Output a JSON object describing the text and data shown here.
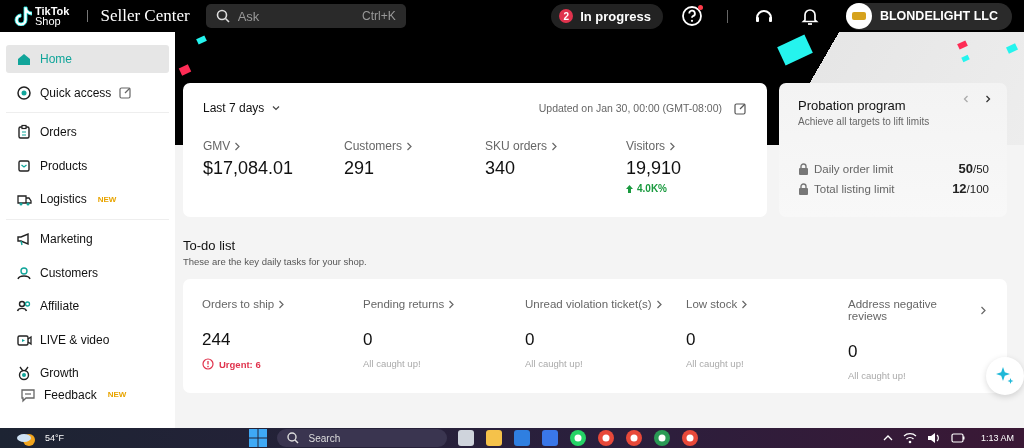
{
  "header": {
    "logo_top": "TikTok",
    "logo_bottom": "Shop",
    "brand": "Seller Center",
    "search": {
      "placeholder": "Ask",
      "shortcut": "Ctrl+K"
    },
    "status": {
      "count": "2",
      "label": "In progress"
    },
    "help_dot": true,
    "account": "BLONDELIGHT LLC"
  },
  "sidebar": {
    "groups": [
      [
        {
          "kind": "home",
          "label": "Home",
          "selected": true
        },
        {
          "kind": "quick",
          "label": "Quick access",
          "selected": false
        }
      ],
      [
        {
          "kind": "orders",
          "label": "Orders",
          "selected": false
        },
        {
          "kind": "products",
          "label": "Products",
          "selected": false
        },
        {
          "kind": "logistics",
          "label": "Logistics",
          "badge": "NEW",
          "selected": false
        }
      ],
      [
        {
          "kind": "marketing",
          "label": "Marketing",
          "selected": false
        },
        {
          "kind": "customers",
          "label": "Customers",
          "selected": false
        },
        {
          "kind": "affiliate",
          "label": "Affiliate",
          "selected": false
        },
        {
          "kind": "live",
          "label": "LIVE & video",
          "selected": false
        },
        {
          "kind": "growth",
          "label": "Growth",
          "selected": false
        }
      ]
    ],
    "feedback": {
      "label": "Feedback",
      "badge": "NEW"
    }
  },
  "overview": {
    "period": "Last 7 days",
    "updated": "Updated on Jan 30, 00:00 (GMT-08:00)",
    "metrics": [
      {
        "label": "GMV",
        "value": "$17,084.01"
      },
      {
        "label": "Customers",
        "value": "291"
      },
      {
        "label": "SKU orders",
        "value": "340"
      },
      {
        "label": "Visitors",
        "value": "19,910",
        "change": "4.0K%"
      }
    ]
  },
  "probation": {
    "title": "Probation program",
    "subtitle": "Achieve all targets to lift limits",
    "limits": [
      {
        "label": "Daily order limit",
        "value": "**50**/50"
      },
      {
        "label": "Total listing limit",
        "value": "**12**/100"
      }
    ]
  },
  "todo": {
    "title": "To-do list",
    "subtitle": "These are the key daily tasks for your shop.",
    "items": [
      {
        "label": "Orders to ship",
        "value": "244",
        "kind": "urgent",
        "note": "Urgent: 6"
      },
      {
        "label": "Pending returns",
        "value": "0",
        "kind": "ok",
        "note": "All caught up!"
      },
      {
        "label": "Unread violation ticket(s)",
        "value": "0",
        "kind": "ok",
        "note": "All caught up!"
      },
      {
        "label": "Low stock",
        "value": "0",
        "kind": "ok",
        "note": "All caught up!"
      },
      {
        "label": "Address negative reviews",
        "value": "0",
        "kind": "ok",
        "note": "All caught up!"
      }
    ]
  },
  "taskbar": {
    "temperature": "54°F",
    "search": "Search",
    "time": "1:13 AM"
  }
}
